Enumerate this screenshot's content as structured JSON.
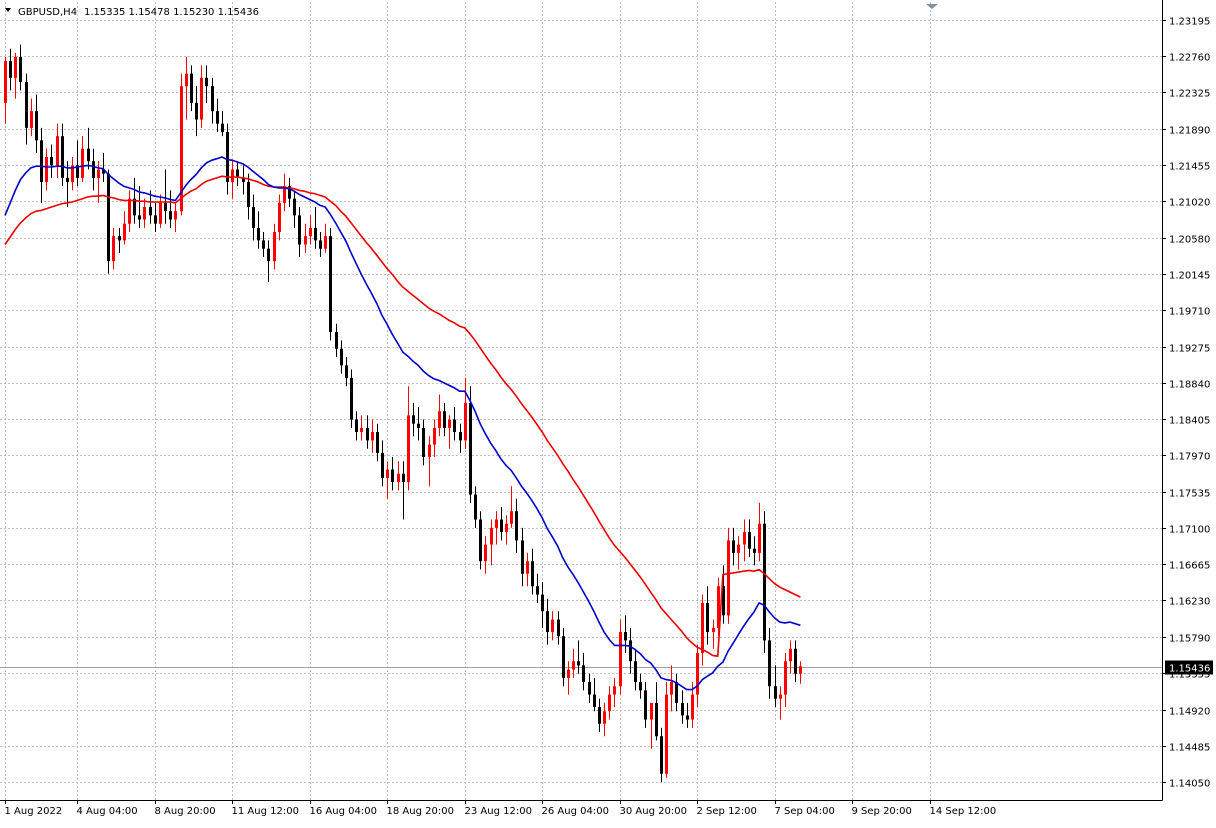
{
  "header": {
    "symbol": "GBPUSD,H4",
    "ohlc": "1.15335 1.15478 1.15230 1.15436"
  },
  "colors": {
    "background": "#ffffff",
    "grid": "#c0c0c0",
    "bull_candle": "#ff0000",
    "bear_candle": "#000000",
    "ma_fast": "#0000cc",
    "ma_slow": "#ee0000",
    "current_price_line": "#a0a0a0",
    "price_label_bg": "#000000"
  },
  "chart_data": {
    "type": "candlestick",
    "instrument": "GBPUSD",
    "timeframe": "H4",
    "current_price": 1.15436,
    "current_price_label": "1.15436",
    "ylim": [
      1.13835,
      1.2341
    ],
    "y_ticks": [
      "1.23195",
      "1.22760",
      "1.22325",
      "1.21890",
      "1.21455",
      "1.21020",
      "1.20580",
      "1.20145",
      "1.19710",
      "1.19275",
      "1.18840",
      "1.18405",
      "1.17970",
      "1.17535",
      "1.17100",
      "1.16665",
      "1.16230",
      "1.15790",
      "1.15355",
      "1.14920",
      "1.14485",
      "1.14050"
    ],
    "x_ticks": [
      {
        "label": "1 Aug 2022",
        "bar": 0
      },
      {
        "label": "4 Aug 04:00",
        "bar": 14
      },
      {
        "label": "8 Aug 20:00",
        "bar": 29
      },
      {
        "label": "11 Aug 12:00",
        "bar": 44
      },
      {
        "label": "16 Aug 04:00",
        "bar": 59
      },
      {
        "label": "18 Aug 20:00",
        "bar": 74
      },
      {
        "label": "23 Aug 12:00",
        "bar": 89
      },
      {
        "label": "26 Aug 04:00",
        "bar": 104
      },
      {
        "label": "30 Aug 20:00",
        "bar": 119
      },
      {
        "label": "2 Sep 12:00",
        "bar": 134
      },
      {
        "label": "7 Sep 04:00",
        "bar": 149
      },
      {
        "label": "9 Sep 20:00",
        "bar": 164
      },
      {
        "label": "14 Sep 12:00",
        "bar": 179
      }
    ],
    "grid": true,
    "candles": [
      [
        1.222,
        1.2275,
        1.2195,
        1.227
      ],
      [
        1.227,
        1.2285,
        1.2235,
        1.225
      ],
      [
        1.225,
        1.228,
        1.2225,
        1.2275
      ],
      [
        1.2275,
        1.229,
        1.2235,
        1.2245
      ],
      [
        1.2245,
        1.2255,
        1.217,
        1.219
      ],
      [
        1.219,
        1.2225,
        1.218,
        1.221
      ],
      [
        1.221,
        1.223,
        1.216,
        1.2175
      ],
      [
        1.2175,
        1.219,
        1.21,
        1.2125
      ],
      [
        1.2125,
        1.2165,
        1.2115,
        1.2155
      ],
      [
        1.2155,
        1.217,
        1.213,
        1.2145
      ],
      [
        1.2145,
        1.2195,
        1.213,
        1.218
      ],
      [
        1.218,
        1.2195,
        1.212,
        1.213
      ],
      [
        1.213,
        1.215,
        1.2095,
        1.2125
      ],
      [
        1.2125,
        1.2155,
        1.2115,
        1.2145
      ],
      [
        1.2145,
        1.2175,
        1.212,
        1.213
      ],
      [
        1.213,
        1.218,
        1.2125,
        1.2165
      ],
      [
        1.2165,
        1.219,
        1.214,
        1.215
      ],
      [
        1.215,
        1.2165,
        1.2115,
        1.213
      ],
      [
        1.213,
        1.215,
        1.21,
        1.214
      ],
      [
        1.214,
        1.216,
        1.2125,
        1.2135
      ],
      [
        1.2135,
        1.214,
        1.2015,
        1.203
      ],
      [
        1.203,
        1.207,
        1.202,
        1.206
      ],
      [
        1.206,
        1.207,
        1.204,
        1.2055
      ],
      [
        1.2055,
        1.209,
        1.205,
        1.2075
      ],
      [
        1.2075,
        1.2115,
        1.2065,
        1.2105
      ],
      [
        1.2105,
        1.213,
        1.2075,
        1.2085
      ],
      [
        1.2085,
        1.212,
        1.207,
        1.208
      ],
      [
        1.208,
        1.2105,
        1.207,
        1.2095
      ],
      [
        1.2095,
        1.2115,
        1.2075,
        1.2085
      ],
      [
        1.2085,
        1.21,
        1.2065,
        1.2075
      ],
      [
        1.2075,
        1.211,
        1.207,
        1.21
      ],
      [
        1.21,
        1.214,
        1.2075,
        1.209
      ],
      [
        1.209,
        1.2115,
        1.207,
        1.208
      ],
      [
        1.208,
        1.21,
        1.2065,
        1.209
      ],
      [
        1.209,
        1.2255,
        1.2085,
        1.224
      ],
      [
        1.224,
        1.2275,
        1.22,
        1.2255
      ],
      [
        1.2255,
        1.2265,
        1.221,
        1.222
      ],
      [
        1.222,
        1.224,
        1.218,
        1.22
      ],
      [
        1.22,
        1.2265,
        1.219,
        1.225
      ],
      [
        1.225,
        1.2265,
        1.222,
        1.224
      ],
      [
        1.224,
        1.225,
        1.2195,
        1.221
      ],
      [
        1.221,
        1.2225,
        1.2185,
        1.2195
      ],
      [
        1.2195,
        1.221,
        1.218,
        1.2185
      ],
      [
        1.2185,
        1.2195,
        1.211,
        1.2125
      ],
      [
        1.2125,
        1.215,
        1.2105,
        1.214
      ],
      [
        1.214,
        1.215,
        1.212,
        1.213
      ],
      [
        1.213,
        1.2145,
        1.211,
        1.2125
      ],
      [
        1.2125,
        1.2135,
        1.208,
        1.2095
      ],
      [
        1.2095,
        1.211,
        1.2055,
        1.207
      ],
      [
        1.207,
        1.209,
        1.2045,
        1.2055
      ],
      [
        1.2055,
        1.2065,
        1.2035,
        1.2045
      ],
      [
        1.2045,
        1.2055,
        1.2005,
        1.203
      ],
      [
        1.203,
        1.2075,
        1.202,
        1.2065
      ],
      [
        1.2065,
        1.211,
        1.2055,
        1.21
      ],
      [
        1.21,
        1.2135,
        1.209,
        1.212
      ],
      [
        1.212,
        1.213,
        1.2095,
        1.2105
      ],
      [
        1.2105,
        1.2115,
        1.207,
        1.2085
      ],
      [
        1.2085,
        1.2095,
        1.2035,
        1.205
      ],
      [
        1.205,
        1.2075,
        1.204,
        1.206
      ],
      [
        1.206,
        1.2085,
        1.205,
        1.207
      ],
      [
        1.207,
        1.2095,
        1.2045,
        1.2055
      ],
      [
        1.2055,
        1.2065,
        1.2035,
        1.2045
      ],
      [
        1.2045,
        1.2075,
        1.204,
        1.206
      ],
      [
        1.206,
        1.207,
        1.1935,
        1.1945
      ],
      [
        1.1945,
        1.1955,
        1.1915,
        1.1925
      ],
      [
        1.1925,
        1.1935,
        1.1895,
        1.1905
      ],
      [
        1.1905,
        1.1915,
        1.188,
        1.189
      ],
      [
        1.189,
        1.19,
        1.183,
        1.184
      ],
      [
        1.184,
        1.185,
        1.1815,
        1.1825
      ],
      [
        1.1825,
        1.1845,
        1.1815,
        1.183
      ],
      [
        1.183,
        1.1845,
        1.1805,
        1.1815
      ],
      [
        1.1815,
        1.184,
        1.18,
        1.1825
      ],
      [
        1.1825,
        1.1835,
        1.179,
        1.18
      ],
      [
        1.18,
        1.1815,
        1.176,
        1.177
      ],
      [
        1.177,
        1.179,
        1.1745,
        1.178
      ],
      [
        1.178,
        1.1795,
        1.1755,
        1.1765
      ],
      [
        1.1765,
        1.179,
        1.1755,
        1.1775
      ],
      [
        1.1775,
        1.179,
        1.172,
        1.1765
      ],
      [
        1.1765,
        1.188,
        1.1755,
        1.1845
      ],
      [
        1.1845,
        1.186,
        1.182,
        1.1835
      ],
      [
        1.1835,
        1.1855,
        1.1815,
        1.183
      ],
      [
        1.183,
        1.184,
        1.1785,
        1.1795
      ],
      [
        1.1795,
        1.182,
        1.176,
        1.181
      ],
      [
        1.181,
        1.184,
        1.1795,
        1.183
      ],
      [
        1.183,
        1.187,
        1.182,
        1.185
      ],
      [
        1.185,
        1.186,
        1.182,
        1.183
      ],
      [
        1.183,
        1.1845,
        1.1805,
        1.184
      ],
      [
        1.184,
        1.1855,
        1.1815,
        1.1825
      ],
      [
        1.1825,
        1.1835,
        1.18,
        1.1815
      ],
      [
        1.1815,
        1.189,
        1.1805,
        1.186
      ],
      [
        1.186,
        1.188,
        1.174,
        1.175
      ],
      [
        1.175,
        1.176,
        1.171,
        1.172
      ],
      [
        1.172,
        1.173,
        1.166,
        1.167
      ],
      [
        1.167,
        1.17,
        1.1655,
        1.169
      ],
      [
        1.169,
        1.172,
        1.1665,
        1.171
      ],
      [
        1.171,
        1.173,
        1.169,
        1.172
      ],
      [
        1.172,
        1.1735,
        1.1695,
        1.1705
      ],
      [
        1.1705,
        1.1725,
        1.169,
        1.1715
      ],
      [
        1.1715,
        1.176,
        1.171,
        1.173
      ],
      [
        1.173,
        1.1745,
        1.168,
        1.1695
      ],
      [
        1.1695,
        1.171,
        1.164,
        1.1655
      ],
      [
        1.1655,
        1.168,
        1.164,
        1.167
      ],
      [
        1.167,
        1.1685,
        1.163,
        1.164
      ],
      [
        1.164,
        1.1655,
        1.162,
        1.163
      ],
      [
        1.163,
        1.1645,
        1.159,
        1.161
      ],
      [
        1.161,
        1.1625,
        1.157,
        1.1585
      ],
      [
        1.1585,
        1.161,
        1.1575,
        1.16
      ],
      [
        1.16,
        1.161,
        1.157,
        1.158
      ],
      [
        1.158,
        1.159,
        1.152,
        1.153
      ],
      [
        1.153,
        1.155,
        1.151,
        1.154
      ],
      [
        1.154,
        1.1565,
        1.153,
        1.155
      ],
      [
        1.155,
        1.1575,
        1.1535,
        1.1545
      ],
      [
        1.1545,
        1.156,
        1.1515,
        1.1525
      ],
      [
        1.1525,
        1.1535,
        1.15,
        1.151
      ],
      [
        1.151,
        1.153,
        1.149,
        1.1495
      ],
      [
        1.1495,
        1.1505,
        1.1465,
        1.1475
      ],
      [
        1.1475,
        1.15,
        1.146,
        1.149
      ],
      [
        1.149,
        1.152,
        1.148,
        1.151
      ],
      [
        1.151,
        1.153,
        1.1495,
        1.152
      ],
      [
        1.152,
        1.16,
        1.151,
        1.1585
      ],
      [
        1.1585,
        1.1605,
        1.156,
        1.1575
      ],
      [
        1.1575,
        1.159,
        1.1535,
        1.155
      ],
      [
        1.155,
        1.1565,
        1.1515,
        1.1525
      ],
      [
        1.1525,
        1.1535,
        1.1505,
        1.1515
      ],
      [
        1.1515,
        1.1525,
        1.147,
        1.148
      ],
      [
        1.148,
        1.1495,
        1.1445,
        1.15
      ],
      [
        1.15,
        1.1525,
        1.1455,
        1.146
      ],
      [
        1.146,
        1.147,
        1.1405,
        1.1415
      ],
      [
        1.1415,
        1.1525,
        1.141,
        1.151
      ],
      [
        1.151,
        1.1545,
        1.149,
        1.1525
      ],
      [
        1.1525,
        1.1535,
        1.149,
        1.15
      ],
      [
        1.15,
        1.1515,
        1.1475,
        1.1485
      ],
      [
        1.1485,
        1.15,
        1.147,
        1.148
      ],
      [
        1.148,
        1.1525,
        1.147,
        1.151
      ],
      [
        1.151,
        1.157,
        1.1495,
        1.156
      ],
      [
        1.156,
        1.163,
        1.1545,
        1.162
      ],
      [
        1.162,
        1.164,
        1.157,
        1.1585
      ],
      [
        1.1585,
        1.16,
        1.1565,
        1.159
      ],
      [
        1.159,
        1.165,
        1.158,
        1.164
      ],
      [
        1.164,
        1.1665,
        1.1595,
        1.1605
      ],
      [
        1.1605,
        1.171,
        1.1595,
        1.1695
      ],
      [
        1.1695,
        1.171,
        1.1665,
        1.168
      ],
      [
        1.168,
        1.17,
        1.166,
        1.169
      ],
      [
        1.169,
        1.172,
        1.167,
        1.1705
      ],
      [
        1.1705,
        1.172,
        1.1675,
        1.1685
      ],
      [
        1.1685,
        1.17,
        1.1665,
        1.168
      ],
      [
        1.168,
        1.174,
        1.167,
        1.1715
      ],
      [
        1.1715,
        1.173,
        1.156,
        1.1575
      ],
      [
        1.1575,
        1.159,
        1.1505,
        1.152
      ],
      [
        1.152,
        1.1545,
        1.1495,
        1.1505
      ],
      [
        1.1505,
        1.152,
        1.148,
        1.151
      ],
      [
        1.151,
        1.156,
        1.1495,
        1.155
      ],
      [
        1.155,
        1.1575,
        1.1535,
        1.1565
      ],
      [
        1.1565,
        1.1575,
        1.1525,
        1.1535
      ],
      [
        1.1535,
        1.155,
        1.1523,
        1.1544
      ]
    ],
    "ma_fast": [
      1.2085,
      1.21,
      1.2115,
      1.2128,
      1.2136,
      1.2142,
      1.2144,
      1.2144,
      1.2143,
      1.2143,
      1.2144,
      1.2144,
      1.2142,
      1.2142,
      1.2143,
      1.2144,
      1.2145,
      1.2144,
      1.2142,
      1.2141,
      1.2134,
      1.2129,
      1.2124,
      1.212,
      1.2118,
      1.2116,
      1.2113,
      1.2112,
      1.211,
      1.2108,
      1.2107,
      1.2106,
      1.2104,
      1.2103,
      1.2112,
      1.2121,
      1.2128,
      1.2134,
      1.2142,
      1.2148,
      1.2151,
      1.2153,
      1.2155,
      1.2152,
      1.2151,
      1.2149,
      1.2147,
      1.2143,
      1.2138,
      1.2133,
      1.2128,
      1.2122,
      1.2119,
      1.2118,
      1.2118,
      1.2117,
      1.2114,
      1.211,
      1.2107,
      1.2104,
      1.2101,
      1.2097,
      1.2095,
      1.2086,
      1.2076,
      1.2065,
      1.2054,
      1.204,
      1.2027,
      1.2014,
      1.2002,
      1.1991,
      1.1979,
      1.1965,
      1.1954,
      1.1942,
      1.1932,
      1.1921,
      1.1916,
      1.191,
      1.1905,
      1.1898,
      1.1893,
      1.1889,
      1.1887,
      1.1884,
      1.1881,
      1.1878,
      1.1874,
      1.1874,
      1.1863,
      1.185,
      1.1835,
      1.1823,
      1.1812,
      1.1803,
      1.1793,
      1.1785,
      1.1779,
      1.177,
      1.176,
      1.1752,
      1.1743,
      1.1733,
      1.1722,
      1.1709,
      1.1699,
      1.1688,
      1.1674,
      1.1663,
      1.1654,
      1.1644,
      1.1633,
      1.1622,
      1.161,
      1.1597,
      1.1585,
      1.1576,
      1.1569,
      1.1569,
      1.1569,
      1.1568,
      1.1564,
      1.1559,
      1.1552,
      1.1548,
      1.154,
      1.153,
      1.1528,
      1.1527,
      1.1524,
      1.152,
      1.1516,
      1.1516,
      1.152,
      1.1528,
      1.1532,
      1.1536,
      1.1544,
      1.1549,
      1.1562,
      1.1572,
      1.1582,
      1.1592,
      1.1601,
      1.1609,
      1.162,
      1.1617,
      1.1609,
      1.1602,
      1.1597,
      1.1596,
      1.1597,
      1.1595,
      1.1593
    ],
    "ma_slow": [
      1.205,
      1.2059,
      1.2068,
      1.2076,
      1.2082,
      1.2087,
      1.209,
      1.2091,
      1.2093,
      1.2095,
      1.2097,
      1.2099,
      1.21,
      1.2101,
      1.2103,
      1.2105,
      1.2107,
      1.2108,
      1.2108,
      1.2109,
      1.2107,
      1.2106,
      1.2104,
      1.2103,
      1.2103,
      1.2103,
      1.2102,
      1.2102,
      1.2101,
      1.2101,
      1.2101,
      1.2101,
      1.2101,
      1.21,
      1.2105,
      1.211,
      1.2114,
      1.2117,
      1.2122,
      1.2126,
      1.2128,
      1.213,
      1.2132,
      1.2131,
      1.2131,
      1.2131,
      1.213,
      1.2129,
      1.2127,
      1.2125,
      1.2122,
      1.212,
      1.2119,
      1.2119,
      1.2119,
      1.2118,
      1.2117,
      1.2115,
      1.2114,
      1.2112,
      1.2111,
      1.2109,
      1.2107,
      1.2102,
      1.2097,
      1.209,
      1.2084,
      1.2076,
      1.2068,
      1.206,
      1.2052,
      1.2045,
      1.2037,
      1.2029,
      1.2021,
      1.2014,
      1.2006,
      1.1999,
      1.1994,
      1.1989,
      1.1984,
      1.1979,
      1.1974,
      1.197,
      1.1967,
      1.1963,
      1.1959,
      1.1956,
      1.1952,
      1.195,
      1.1943,
      1.1935,
      1.1926,
      1.1917,
      1.1908,
      1.19,
      1.1891,
      1.1883,
      1.1876,
      1.1868,
      1.1859,
      1.1851,
      1.1843,
      1.1834,
      1.1825,
      1.1815,
      1.1806,
      1.1797,
      1.1787,
      1.1778,
      1.1768,
      1.1759,
      1.1749,
      1.1739,
      1.1729,
      1.1718,
      1.1708,
      1.1698,
      1.1689,
      1.1682,
      1.1675,
      1.1667,
      1.1659,
      1.1651,
      1.1642,
      1.1633,
      1.1624,
      1.1614,
      1.1607,
      1.16,
      1.1593,
      1.1586,
      1.1578,
      1.1572,
      1.1567,
      1.1564,
      1.1561,
      1.1557,
      1.1556,
      1.1654,
      1.1655,
      1.1656,
      1.1657,
      1.1658,
      1.1659,
      1.1658,
      1.166,
      1.1655,
      1.1649,
      1.1643,
      1.1639,
      1.1636,
      1.1633,
      1.163,
      1.1627
    ]
  }
}
